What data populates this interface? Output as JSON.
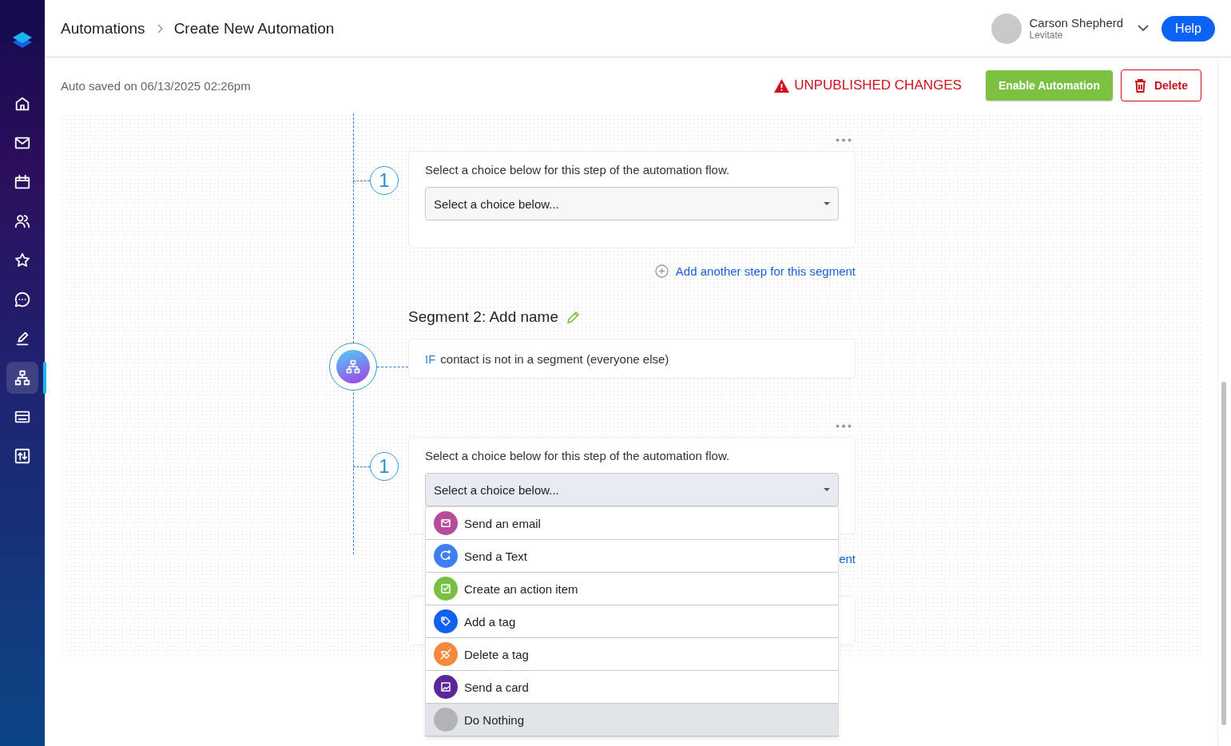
{
  "sidebar": {
    "items": [
      {
        "selected": false
      },
      {
        "selected": false
      },
      {
        "selected": false
      },
      {
        "selected": false
      },
      {
        "selected": false
      },
      {
        "selected": false
      },
      {
        "selected": false
      },
      {
        "selected": true
      },
      {
        "selected": false
      },
      {
        "selected": false
      }
    ]
  },
  "breadcrumb": [
    "Automations",
    "Create New Automation"
  ],
  "user": {
    "name": "Carson Shepherd",
    "org": "Levitate"
  },
  "help_button": "Help",
  "toolbar": {
    "autosave": "Auto saved on 06/13/2025 02:26pm",
    "warning": "UNPUBLISHED CHANGES",
    "enable_button": "Enable Automation",
    "delete_button": "Delete"
  },
  "flow": {
    "step_1": {
      "number": "1",
      "prompt": "Select a choice below for this step of the automation flow.",
      "placeholder": "Select a choice below...",
      "open": false
    },
    "add_step_link": "Add another step for this segment",
    "segment": {
      "title": "Segment 2: Add name",
      "keyword": "IF",
      "condition": "contact is not in a segment (everyone else)"
    },
    "step_2": {
      "number": "1",
      "prompt": "Select a choice below for this step of the automation flow.",
      "placeholder": "Select a choice below...",
      "open": true,
      "options": [
        {
          "label": "Send an email",
          "color": "#b94b9b",
          "selected": false
        },
        {
          "label": "Send a Text",
          "color": "#3d7ff0",
          "selected": false
        },
        {
          "label": "Create an action item",
          "color": "#78c044",
          "selected": false
        },
        {
          "label": "Add a tag",
          "color": "#1160ef",
          "selected": false
        },
        {
          "label": "Delete a tag",
          "color": "#f4883c",
          "selected": false
        },
        {
          "label": "Send a card",
          "color": "#5a2896",
          "selected": false
        },
        {
          "label": "Do Nothing",
          "color": "#b3b3b3",
          "selected": true
        }
      ]
    },
    "add_step_link_2": "ent"
  }
}
